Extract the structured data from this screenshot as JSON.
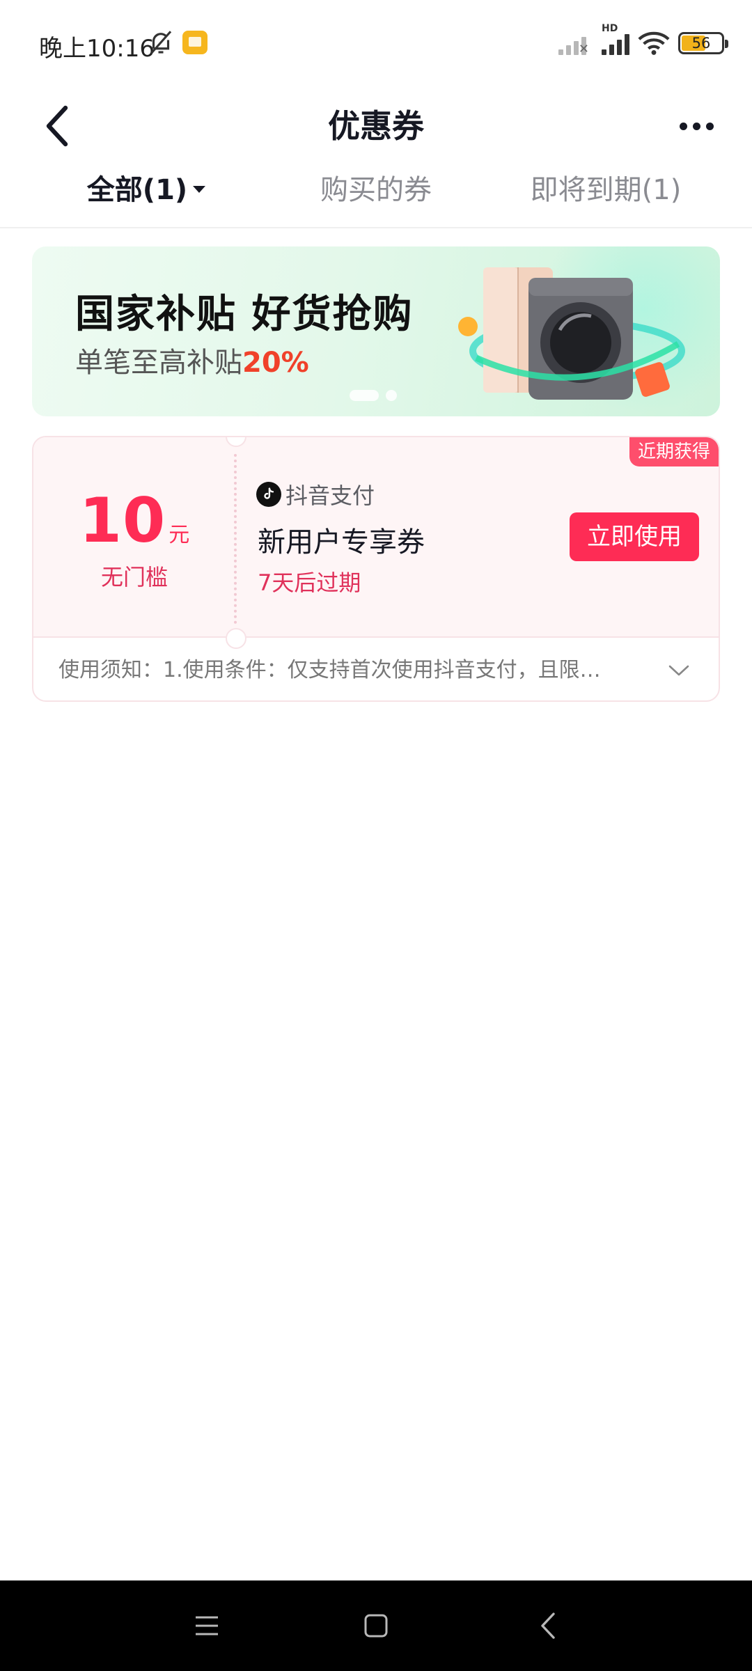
{
  "status_bar": {
    "time": "晚上10:16",
    "network_label": "HD",
    "battery_level": "56",
    "icons": [
      "bell-muted-icon",
      "notes-app-icon",
      "signal-sim2-off-icon",
      "signal-icon",
      "wifi-icon",
      "battery-icon"
    ]
  },
  "header": {
    "title": "优惠券",
    "back_icon": "chevron-left-icon",
    "more_icon": "more-dots-icon"
  },
  "tabs": [
    {
      "label": "全部(1)",
      "active": true
    },
    {
      "label": "购买的券",
      "active": false
    },
    {
      "label": "即将到期(1)",
      "active": false
    }
  ],
  "banner": {
    "title": "国家补贴 好货抢购",
    "subtitle_prefix": "单笔至高补贴",
    "subtitle_highlight": "20%",
    "page_count": 2,
    "current_page": 1
  },
  "coupon": {
    "amount": "10",
    "unit": "元",
    "threshold": "无门槛",
    "badge": "近期获得",
    "issuer": "抖音支付",
    "name": "新用户专享券",
    "expiry": "7天后过期",
    "action_label": "立即使用",
    "notice": "使用须知：1.使用条件：仅支持首次使用抖音支付，且限…"
  },
  "colors": {
    "accent": "#fe2c55",
    "badge": "#fe4e6c",
    "banner_highlight": "#f0412a"
  }
}
